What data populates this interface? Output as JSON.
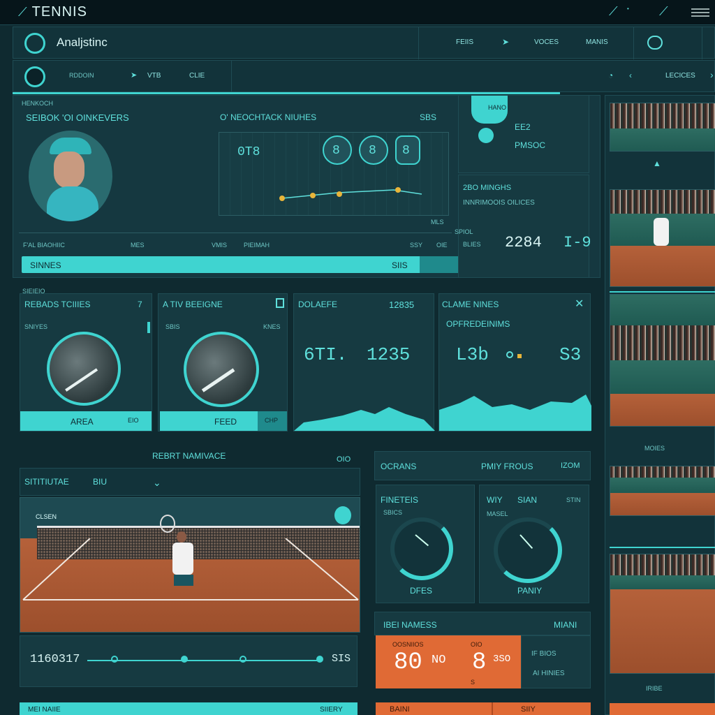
{
  "app": {
    "title": "TENNIS"
  },
  "topbar": {
    "icons": [
      "racket-icon",
      "racket-icon",
      "hamburger-menu-icon"
    ]
  },
  "nav1": {
    "title": "Analjstinc",
    "tabs": [
      "FEIIS",
      "VOCES",
      "MANIS"
    ]
  },
  "nav2": {
    "labels": [
      "RDDOIN",
      "VTB",
      "CLIE"
    ],
    "right_label": "LECICES"
  },
  "profile_panel": {
    "header_small": "HENKOCH",
    "heading": "SEIBOK 'OI OINKEVERS",
    "chart_heading": "O' NEOCHTACK NIUHES",
    "chart_tag": "SBS",
    "chart_digits": [
      "0T8",
      "8",
      "8",
      "8"
    ],
    "chart_foot": "MLS",
    "row_labels": [
      "F'AL BIAOHIIC",
      "MES",
      "VMIS",
      "PIEIMAh",
      "SSY",
      "OIE"
    ],
    "bar_label": "SINNES",
    "bar_value": "SIIS"
  },
  "side_stats": {
    "tag_label": "HANO",
    "top_value": "EE2",
    "top_label": "PMSOC",
    "mid_label": "2BO MINGHS",
    "mid_sub": "INNRIMOOIS OILICES",
    "left_label": "SPIOL",
    "left_sub": "BLIES",
    "score_a": "2284",
    "score_b": "I-9"
  },
  "section2": {
    "small": "SIEIEIO"
  },
  "card1": {
    "title": "REBADS TCIIIES",
    "num": "7",
    "sub": "SNIYES",
    "foot": "AREA",
    "foot_tag": "EIO"
  },
  "card2": {
    "title": "A TIV BEEIGNE",
    "sub": "SBIS",
    "sub_val": "KNES",
    "foot": "FEED",
    "foot_tag": "CHP"
  },
  "card3": {
    "title": "DOLAEFE",
    "value": "12835",
    "stat_a": "6TI.",
    "stat_b": "1235"
  },
  "card4": {
    "title": "CLAME NINES",
    "sub": "OPFREDEINIMS",
    "stat_a": "L3b",
    "stat_b": "S3"
  },
  "match": {
    "header": "REBRT NAMIVACE",
    "header_value": "OIO",
    "title": "SITITIUTAE",
    "title_val": "BIU",
    "tag": "CLSEN"
  },
  "timeline": {
    "start": "1160317",
    "end": "SIS"
  },
  "bottom_left": {
    "label": "MEI NAIIE",
    "value": "SIIERY"
  },
  "stats_panel": {
    "header_a": "OCRANS",
    "header_b": "PMIY FROUS",
    "header_c": "IZOM",
    "g1_title": "FINETEIS",
    "g1_sub": "SBICS",
    "g1_foot": "DFES",
    "g2_title": "WIY",
    "g2_title_b": "SIAN",
    "g2_tag": "STIN",
    "g2_sub": "MASEL",
    "g2_foot": "PANIY"
  },
  "score_panel": {
    "title": "IBEI NAMESS",
    "title_right": "MIANI",
    "small_a": "OOSNIIOS",
    "small_b": "OIO",
    "score_a": "80",
    "mid": "NO",
    "score_b": "8",
    "score_c": "3SO",
    "foot": "S",
    "right_a": "IF BIOS",
    "right_b": "AI HINIES",
    "bottom_a": "BAINI",
    "bottom_b": "SIIY"
  },
  "right_rail": {
    "caption_1": "MOIES",
    "caption_2": "IRIBE"
  },
  "colors": {
    "accent": "#3fd4d0",
    "bg": "#0f2a30",
    "panel": "#163a41",
    "orange": "#e06a35",
    "clay": "#b5613a"
  }
}
